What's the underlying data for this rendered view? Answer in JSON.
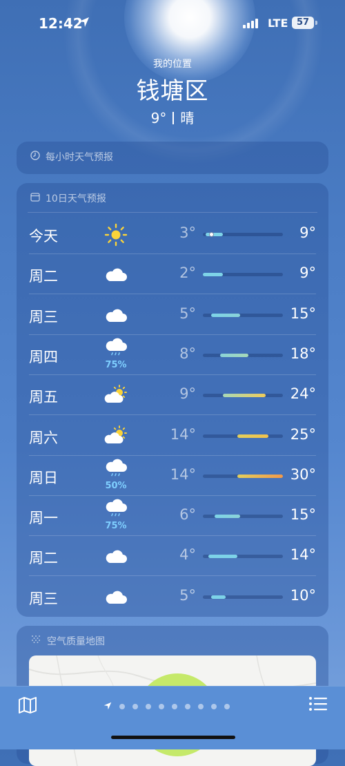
{
  "status_bar": {
    "time": "12:42",
    "network": "LTE",
    "battery": "57"
  },
  "header": {
    "my_location_label": "我的位置",
    "city": "钱塘区",
    "current_temp": "9°",
    "condition": "晴"
  },
  "hourly_card": {
    "title": "每小时天气预报",
    "icon": "clock-icon"
  },
  "daily_card": {
    "title": "10日天气预报",
    "icon": "calendar-icon",
    "range_min": 2,
    "range_max": 30,
    "days": [
      {
        "day": "今天",
        "icon": "sun-icon",
        "precip": "",
        "low": "3°",
        "high": "9°",
        "low_val": 3,
        "high_val": 9,
        "current": 9,
        "color_start": "#7dd3e8",
        "color_end": "#7dd3e8"
      },
      {
        "day": "周二",
        "icon": "cloud-icon",
        "precip": "",
        "low": "2°",
        "high": "9°",
        "low_val": 2,
        "high_val": 9,
        "color_start": "#7dd3e8",
        "color_end": "#7dd3e8"
      },
      {
        "day": "周三",
        "icon": "cloud-icon",
        "precip": "",
        "low": "5°",
        "high": "15°",
        "low_val": 5,
        "high_val": 15,
        "color_start": "#7dd3e8",
        "color_end": "#8ad3d8"
      },
      {
        "day": "周四",
        "icon": "cloud-rain-icon",
        "precip": "75%",
        "low": "8°",
        "high": "18°",
        "low_val": 8,
        "high_val": 18,
        "color_start": "#8ad3d8",
        "color_end": "#a7d8b8"
      },
      {
        "day": "周五",
        "icon": "partly-cloudy-icon",
        "precip": "",
        "low": "9°",
        "high": "24°",
        "low_val": 9,
        "high_val": 24,
        "color_start": "#a7d8b8",
        "color_end": "#f0cc5a"
      },
      {
        "day": "周六",
        "icon": "partly-cloudy-icon",
        "precip": "",
        "low": "14°",
        "high": "25°",
        "low_val": 14,
        "high_val": 25,
        "color_start": "#e3cf5c",
        "color_end": "#f2c24c"
      },
      {
        "day": "周日",
        "icon": "cloud-rain-icon",
        "precip": "50%",
        "low": "14°",
        "high": "30°",
        "low_val": 14,
        "high_val": 30,
        "color_start": "#e3cf5c",
        "color_end": "#f1994a"
      },
      {
        "day": "周一",
        "icon": "cloud-rain-icon",
        "precip": "75%",
        "low": "6°",
        "high": "15°",
        "low_val": 6,
        "high_val": 15,
        "color_start": "#7dd3e8",
        "color_end": "#8ad3d8"
      },
      {
        "day": "周二",
        "icon": "cloud-icon",
        "precip": "",
        "low": "4°",
        "high": "14°",
        "low_val": 4,
        "high_val": 14,
        "color_start": "#7dd3e8",
        "color_end": "#7dd3e8"
      },
      {
        "day": "周三",
        "icon": "cloud-icon",
        "precip": "",
        "low": "5°",
        "high": "10°",
        "low_val": 5,
        "high_val": 10,
        "color_start": "#7dd3e8",
        "color_end": "#7dd3e8"
      }
    ]
  },
  "air_quality_card": {
    "title": "空气质量地图",
    "icon": "air-quality-icon"
  },
  "tab_bar": {
    "map_icon": "map-icon",
    "list_icon": "list-icon",
    "page_count": 9
  }
}
